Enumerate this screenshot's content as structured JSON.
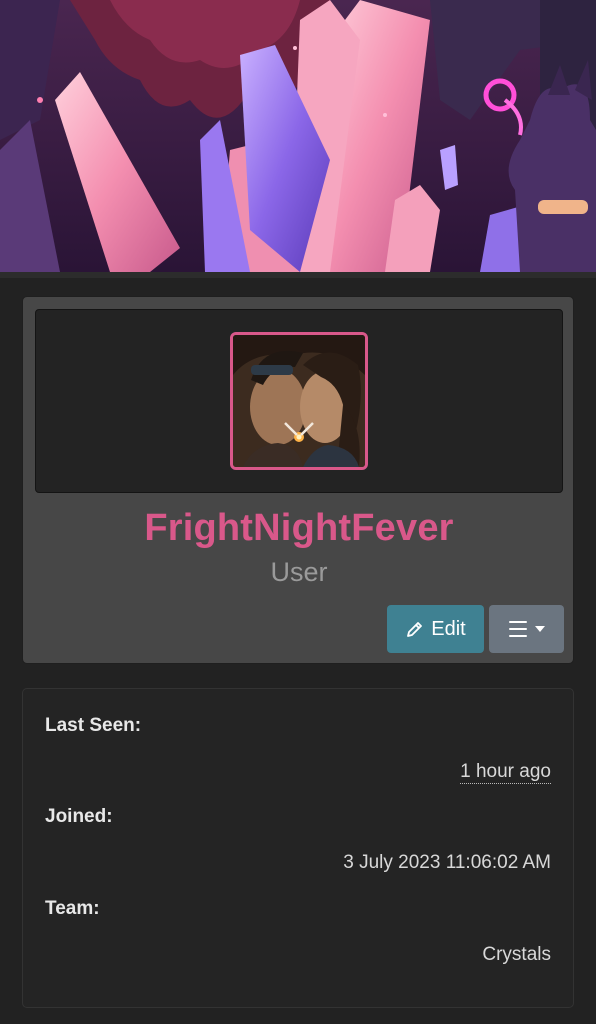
{
  "profile": {
    "username": "FrightNightFever",
    "role": "User",
    "edit_label": "Edit"
  },
  "details": {
    "last_seen_label": "Last Seen:",
    "last_seen_value": "1 hour ago",
    "joined_label": "Joined:",
    "joined_value": "3 July 2023 11:06:02 AM",
    "team_label": "Team:",
    "team_value": "Crystals"
  },
  "colors": {
    "accent_pink": "#d9588a",
    "edit_button": "#3f8192",
    "menu_button": "#6b7580",
    "card_bg": "#474747",
    "page_bg": "#222222"
  },
  "icons": {
    "edit": "pencil-icon",
    "menu": "hamburger-icon",
    "dropdown": "caret-down-icon"
  }
}
